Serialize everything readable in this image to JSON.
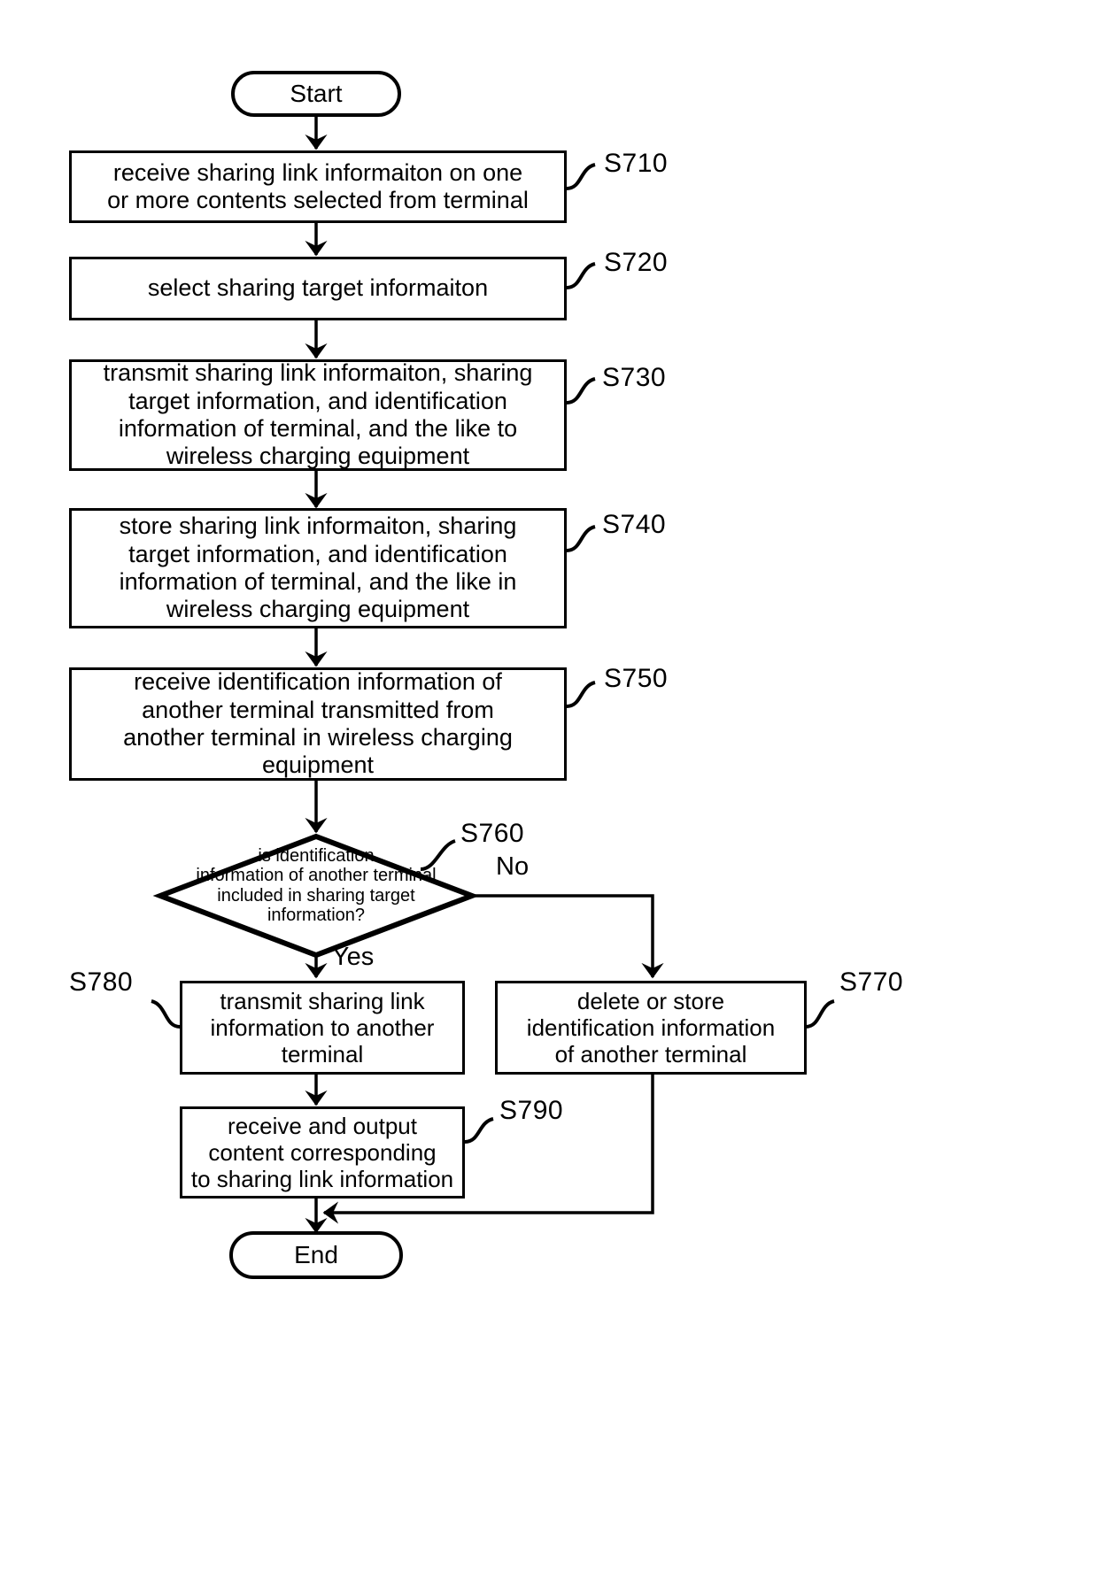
{
  "diagram": {
    "type": "patent-flowchart",
    "start_label": "Start",
    "end_label": "End",
    "yes_label": "Yes",
    "no_label": "No",
    "stroke_color": "#000000",
    "background_color": "#ffffff"
  },
  "nodes": {
    "start": {
      "text": "Start"
    },
    "s710": {
      "ref": "S710",
      "text": "receive sharing link informaiton on one\nor more contents selected from terminal"
    },
    "s720": {
      "ref": "S720",
      "text": "select sharing target informaiton"
    },
    "s730": {
      "ref": "S730",
      "text": "transmit sharing link informaiton, sharing\ntarget information, and identification\ninformation of terminal, and the like to\nwireless charging equipment"
    },
    "s740": {
      "ref": "S740",
      "text": "store sharing link informaiton, sharing\ntarget information, and identification\ninformation of terminal, and the like in\nwireless charging equipment"
    },
    "s750": {
      "ref": "S750",
      "text": "receive identification information of\nanother terminal transmitted from\nanother terminal in wireless charging\nequipment"
    },
    "s760": {
      "ref": "S760",
      "text": "is identification\ninformation of another terminal\nincluded in sharing target\ninformation?"
    },
    "s770": {
      "ref": "S770",
      "text": "delete or store\nidentification information\nof another terminal"
    },
    "s780": {
      "ref": "S780",
      "text": "transmit sharing link\ninformation to another\nterminal"
    },
    "s790": {
      "ref": "S790",
      "text": "receive and output\ncontent corresponding\nto sharing link information"
    },
    "end": {
      "text": "End"
    }
  }
}
